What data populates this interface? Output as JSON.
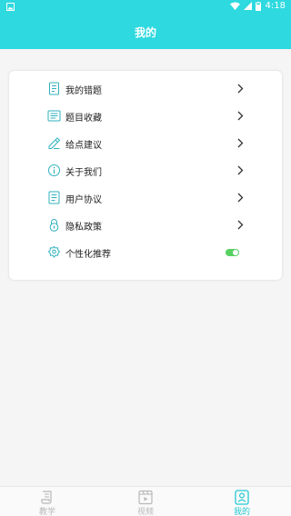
{
  "status_bar": {
    "time": "4:18",
    "icons": [
      "gallery-icon",
      "wifi-icon",
      "signal-icon",
      "battery-icon"
    ]
  },
  "header": {
    "title": "我的"
  },
  "menu": {
    "items": [
      {
        "label": "我的错题",
        "icon": "wrong-questions-icon"
      },
      {
        "label": "题目收藏",
        "icon": "favorites-icon"
      },
      {
        "label": "给点建议",
        "icon": "feedback-icon"
      },
      {
        "label": "关于我们",
        "icon": "info-icon"
      },
      {
        "label": "用户协议",
        "icon": "agreement-icon"
      },
      {
        "label": "隐私政策",
        "icon": "privacy-lock-icon"
      },
      {
        "label": "个性化推荐",
        "icon": "personalization-icon",
        "toggle_on": true
      }
    ]
  },
  "tabbar": {
    "tabs": [
      {
        "label": "教学",
        "icon": "scroll-icon",
        "active": false
      },
      {
        "label": "视频",
        "icon": "video-icon",
        "active": false
      },
      {
        "label": "我的",
        "icon": "profile-icon",
        "active": true
      }
    ]
  },
  "colors": {
    "accent": "#2ed9df",
    "toggle_on": "#58d163",
    "inactive_tab": "#b8b8b8"
  }
}
